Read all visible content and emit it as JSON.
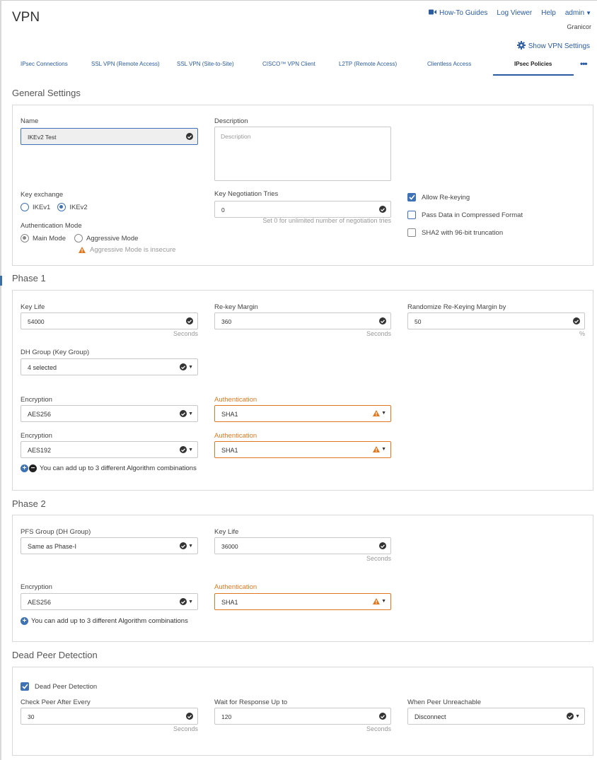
{
  "header": {
    "title": "VPN",
    "links": {
      "howto": "How-To Guides",
      "logviewer": "Log Viewer",
      "help": "Help",
      "admin": "admin"
    },
    "org": "Granicor",
    "show_vpn_settings": "Show VPN Settings"
  },
  "tabs": [
    {
      "label": "IPsec Connections"
    },
    {
      "label": "SSL VPN (Remote Access)"
    },
    {
      "label": "SSL VPN (Site-to-Site)"
    },
    {
      "label": "CISCO™ VPN Client"
    },
    {
      "label": "L2TP (Remote Access)"
    },
    {
      "label": "Clientless Access"
    },
    {
      "label": "IPsec Policies"
    }
  ],
  "tab_more": "•••",
  "general": {
    "title": "General Settings",
    "name_label": "Name",
    "name_value": "IKEv2 Test",
    "description_label": "Description",
    "description_placeholder": "Description",
    "key_exchange_label": "Key exchange",
    "ikev1": "IKEv1",
    "ikev2": "IKEv2",
    "key_tries_label": "Key Negotiation Tries",
    "key_tries_value": "0",
    "key_tries_hint": "Set 0 for unlimited number of negotiation tries",
    "auth_mode_label": "Authentication Mode",
    "main_mode": "Main Mode",
    "aggressive_mode": "Aggressive Mode",
    "aggressive_warning": "Aggressive Mode is insecure",
    "allow_rekeying": "Allow Re-keying",
    "pass_compressed": "Pass Data in Compressed Format",
    "sha2_truncation": "SHA2 with 96-bit truncation"
  },
  "phase1": {
    "title": "Phase 1",
    "key_life_label": "Key Life",
    "key_life_value": "54000",
    "rekey_margin_label": "Re-key Margin",
    "rekey_margin_value": "360",
    "randomize_label": "Randomize Re-Keying Margin by",
    "randomize_value": "50",
    "seconds": "Seconds",
    "percent": "%",
    "dh_group_label": "DH Group (Key Group)",
    "dh_group_value": "4 selected",
    "encryption_label": "Encryption",
    "authentication_label": "Authentication",
    "rows": [
      {
        "encryption": "AES256",
        "authentication": "SHA1"
      },
      {
        "encryption": "AES192",
        "authentication": "SHA1"
      }
    ],
    "add_hint": "You can add up to 3 different Algorithm combinations"
  },
  "phase2": {
    "title": "Phase 2",
    "pfs_label": "PFS Group (DH Group)",
    "pfs_value": "Same as Phase-I",
    "key_life_label": "Key Life",
    "key_life_value": "36000",
    "seconds": "Seconds",
    "encryption_label": "Encryption",
    "encryption_value": "AES256",
    "authentication_label": "Authentication",
    "authentication_value": "SHA1",
    "add_hint": "You can add up to 3 different Algorithm combinations"
  },
  "dpd": {
    "title": "Dead Peer Detection",
    "checkbox_label": "Dead Peer Detection",
    "check_after_label": "Check Peer After Every",
    "check_after_value": "30",
    "wait_label": "Wait for Response Up to",
    "wait_value": "120",
    "seconds": "Seconds",
    "unreachable_label": "When Peer Unreachable",
    "unreachable_value": "Disconnect"
  },
  "colors": {
    "accent": "#3f72b5",
    "link": "#2a5ba0",
    "warning": "#e0771e",
    "border": "#d9d9d9"
  }
}
